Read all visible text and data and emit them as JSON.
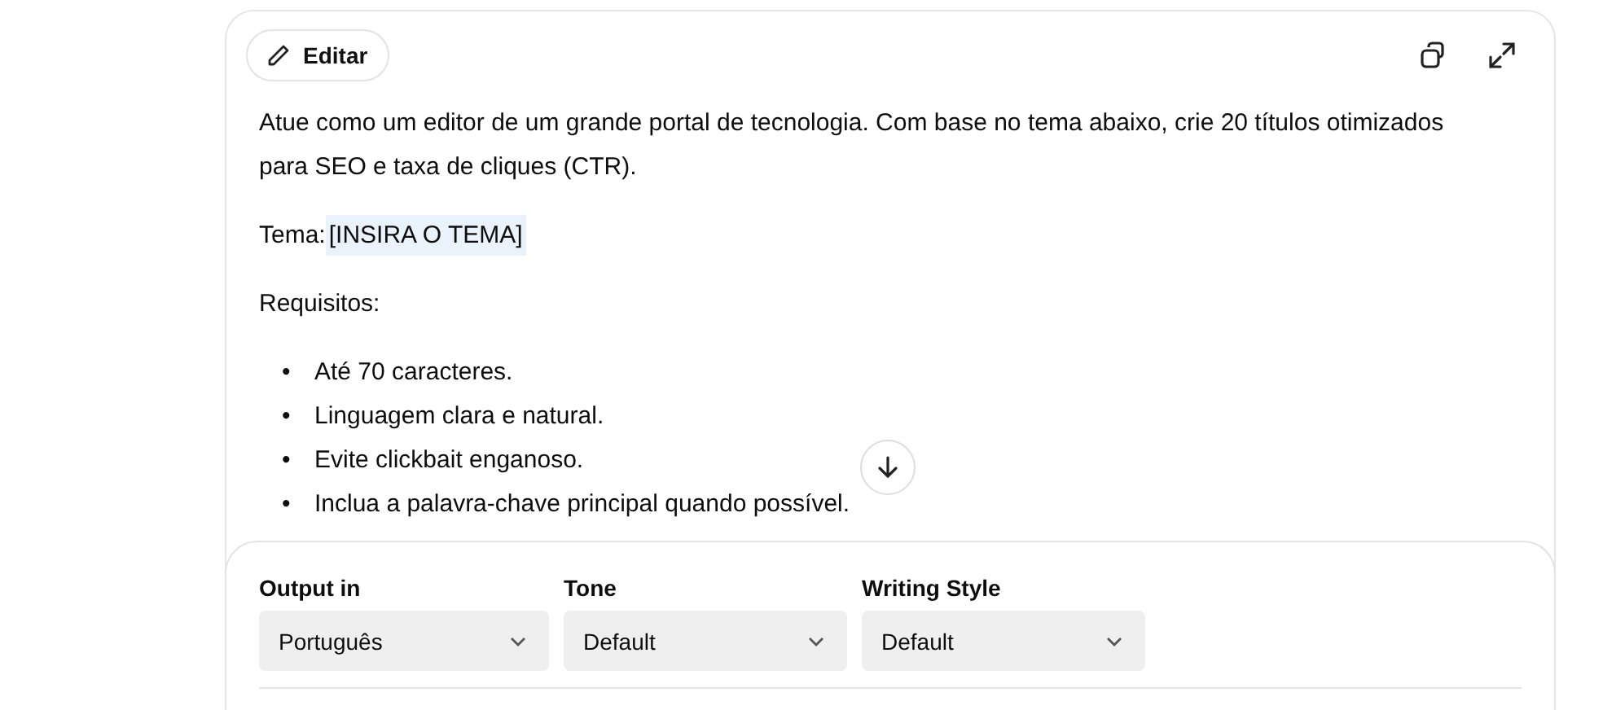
{
  "toolbar": {
    "edit_label": "Editar"
  },
  "prompt": {
    "intro": "Atue como um editor de um grande portal de tecnologia. Com base no tema abaixo, crie 20 títulos otimizados para SEO e taxa de cliques (CTR).",
    "topic": {
      "label": "Tema:",
      "value": "[INSIRA O TEMA]"
    },
    "requirements_title": "Requisitos:",
    "requirements": [
      {
        "marker": "•",
        "text": "Até 70 caracteres."
      },
      {
        "marker": "•",
        "text": "Linguagem clara e natural."
      },
      {
        "marker": "•",
        "text": "Evite clickbait enganoso."
      },
      {
        "marker": "•",
        "text": "Inclua a palavra-chave principal quando possível."
      }
    ]
  },
  "settings": [
    {
      "label": "Output in",
      "value": "Português"
    },
    {
      "label": "Tone",
      "value": "Default"
    },
    {
      "label": "Writing Style",
      "value": "Default"
    }
  ]
}
